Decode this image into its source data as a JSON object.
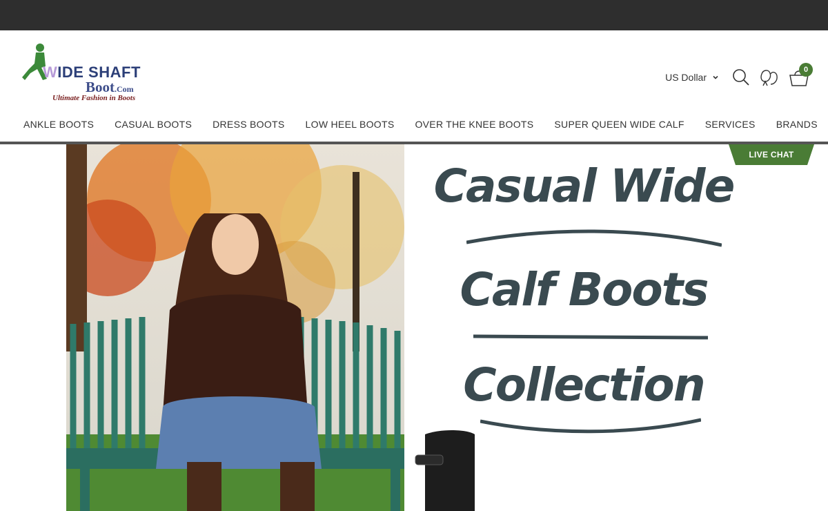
{
  "logo": {
    "line1_w": "W",
    "line1_rest": "IDE SHAFT",
    "line2": "Boot",
    "line2_suffix": ".Com",
    "tagline": "Ultimate Fashion in Boots"
  },
  "header": {
    "currency": "US Dollar",
    "cart_count": "0",
    "icons": [
      "search-icon",
      "account-icon",
      "cart-icon"
    ]
  },
  "nav": {
    "items": [
      {
        "label": "ANKLE BOOTS"
      },
      {
        "label": "CASUAL BOOTS"
      },
      {
        "label": "DRESS BOOTS"
      },
      {
        "label": "LOW HEEL BOOTS"
      },
      {
        "label": "OVER THE KNEE BOOTS"
      },
      {
        "label": "SUPER QUEEN WIDE CALF"
      },
      {
        "label": "SERVICES"
      },
      {
        "label": "BRANDS"
      }
    ]
  },
  "banner": {
    "line1": "Casual Wide",
    "line2": "Calf Boots",
    "line3": "Collection"
  },
  "live_chat": {
    "label": "LIVE CHAT",
    "color": "#4a7c35"
  },
  "colors": {
    "topbar": "#2e2e2e",
    "accent": "#4a7c35",
    "banner_text": "#3a4a50"
  }
}
